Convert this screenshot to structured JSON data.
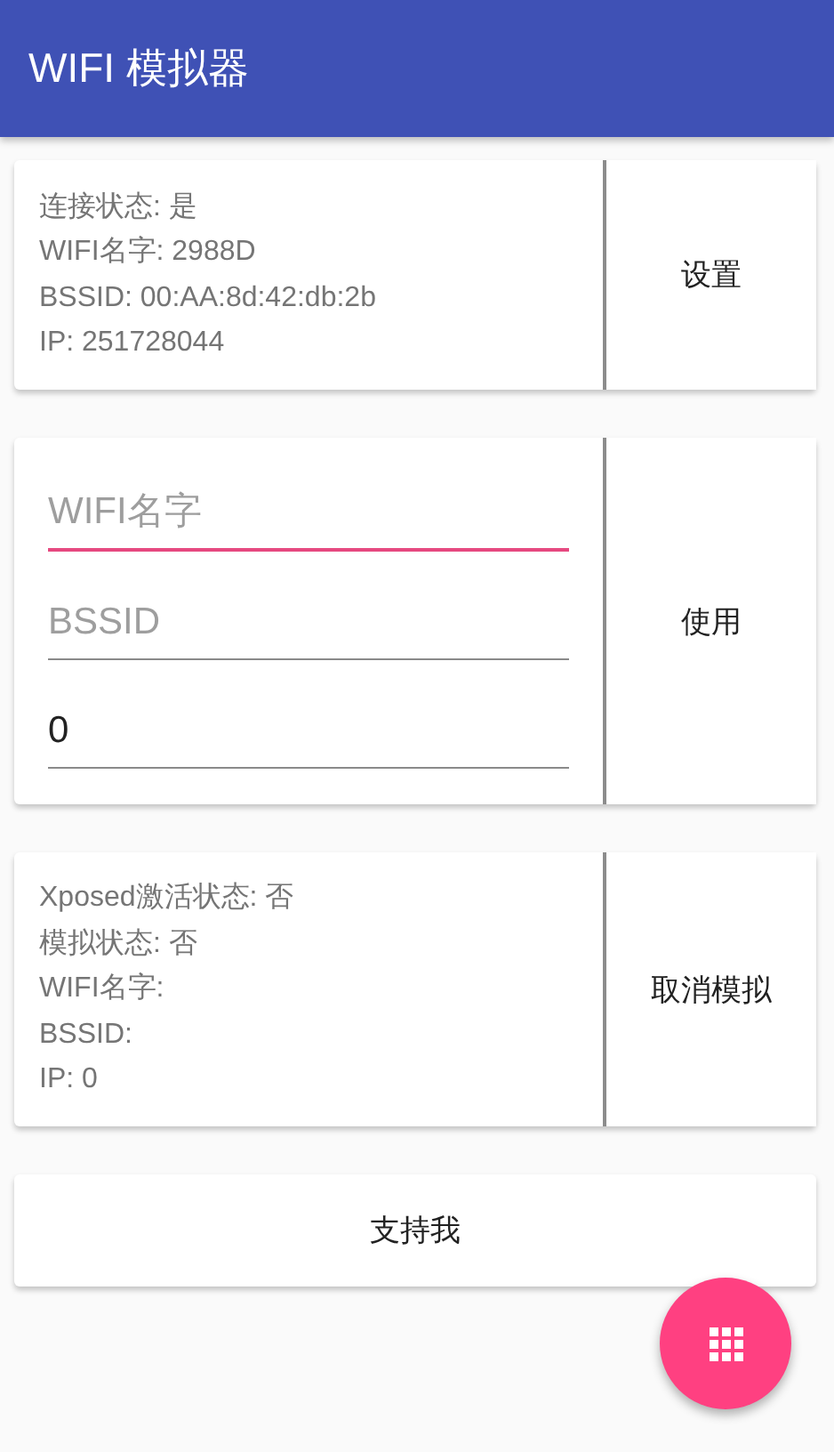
{
  "app_bar": {
    "title": "WIFI 模拟器"
  },
  "status_card": {
    "lines": [
      "连接状态: 是",
      "WIFI名字: 2988D",
      "BSSID: 00:AA:8d:42:db:2b",
      "IP: 251728044"
    ],
    "button": "设置"
  },
  "input_card": {
    "fields": [
      {
        "placeholder": "WIFI名字",
        "focused": true
      },
      {
        "placeholder": "BSSID",
        "focused": false
      },
      {
        "value": "0",
        "focused": false
      }
    ],
    "button": "使用"
  },
  "simulation_card": {
    "lines": [
      "Xposed激活状态: 否",
      "模拟状态: 否",
      "WIFI名字:",
      "BSSID:",
      "IP: 0"
    ],
    "button": "取消模拟"
  },
  "support_button": "支持我",
  "fab": {
    "kind": "grid"
  }
}
